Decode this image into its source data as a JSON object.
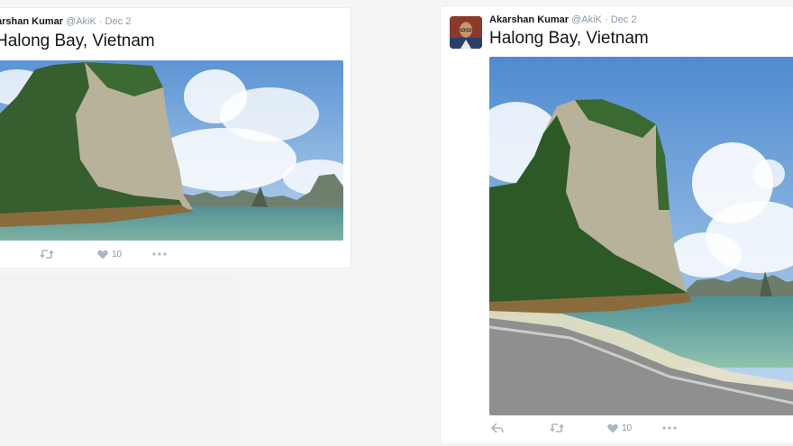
{
  "tweets": [
    {
      "author_name": "Akarshan Kumar",
      "author_name_visible": "arshan Kumar",
      "handle": "@AkiK",
      "separator": "·",
      "date": "Dec 2",
      "text": "Halong Bay, Vietnam",
      "image": "halong-bay-photo-landscape",
      "like_count": "10"
    },
    {
      "author_name": "Akarshan Kumar",
      "handle": "@AkiK",
      "separator": "·",
      "date": "Dec 2",
      "text": "Halong Bay, Vietnam",
      "image": "halong-bay-photo-portrait",
      "like_count": "10"
    }
  ],
  "icons": {
    "reply": "reply-icon",
    "retweet": "retweet-icon",
    "like": "heart-icon",
    "more": "more-icon"
  },
  "colors": {
    "sky": "#6f9fd6",
    "sea": "#5f9c9a",
    "rock": "#b5b09a",
    "foliage": "#2f5a2a",
    "action_gray": "#aab8c2"
  }
}
